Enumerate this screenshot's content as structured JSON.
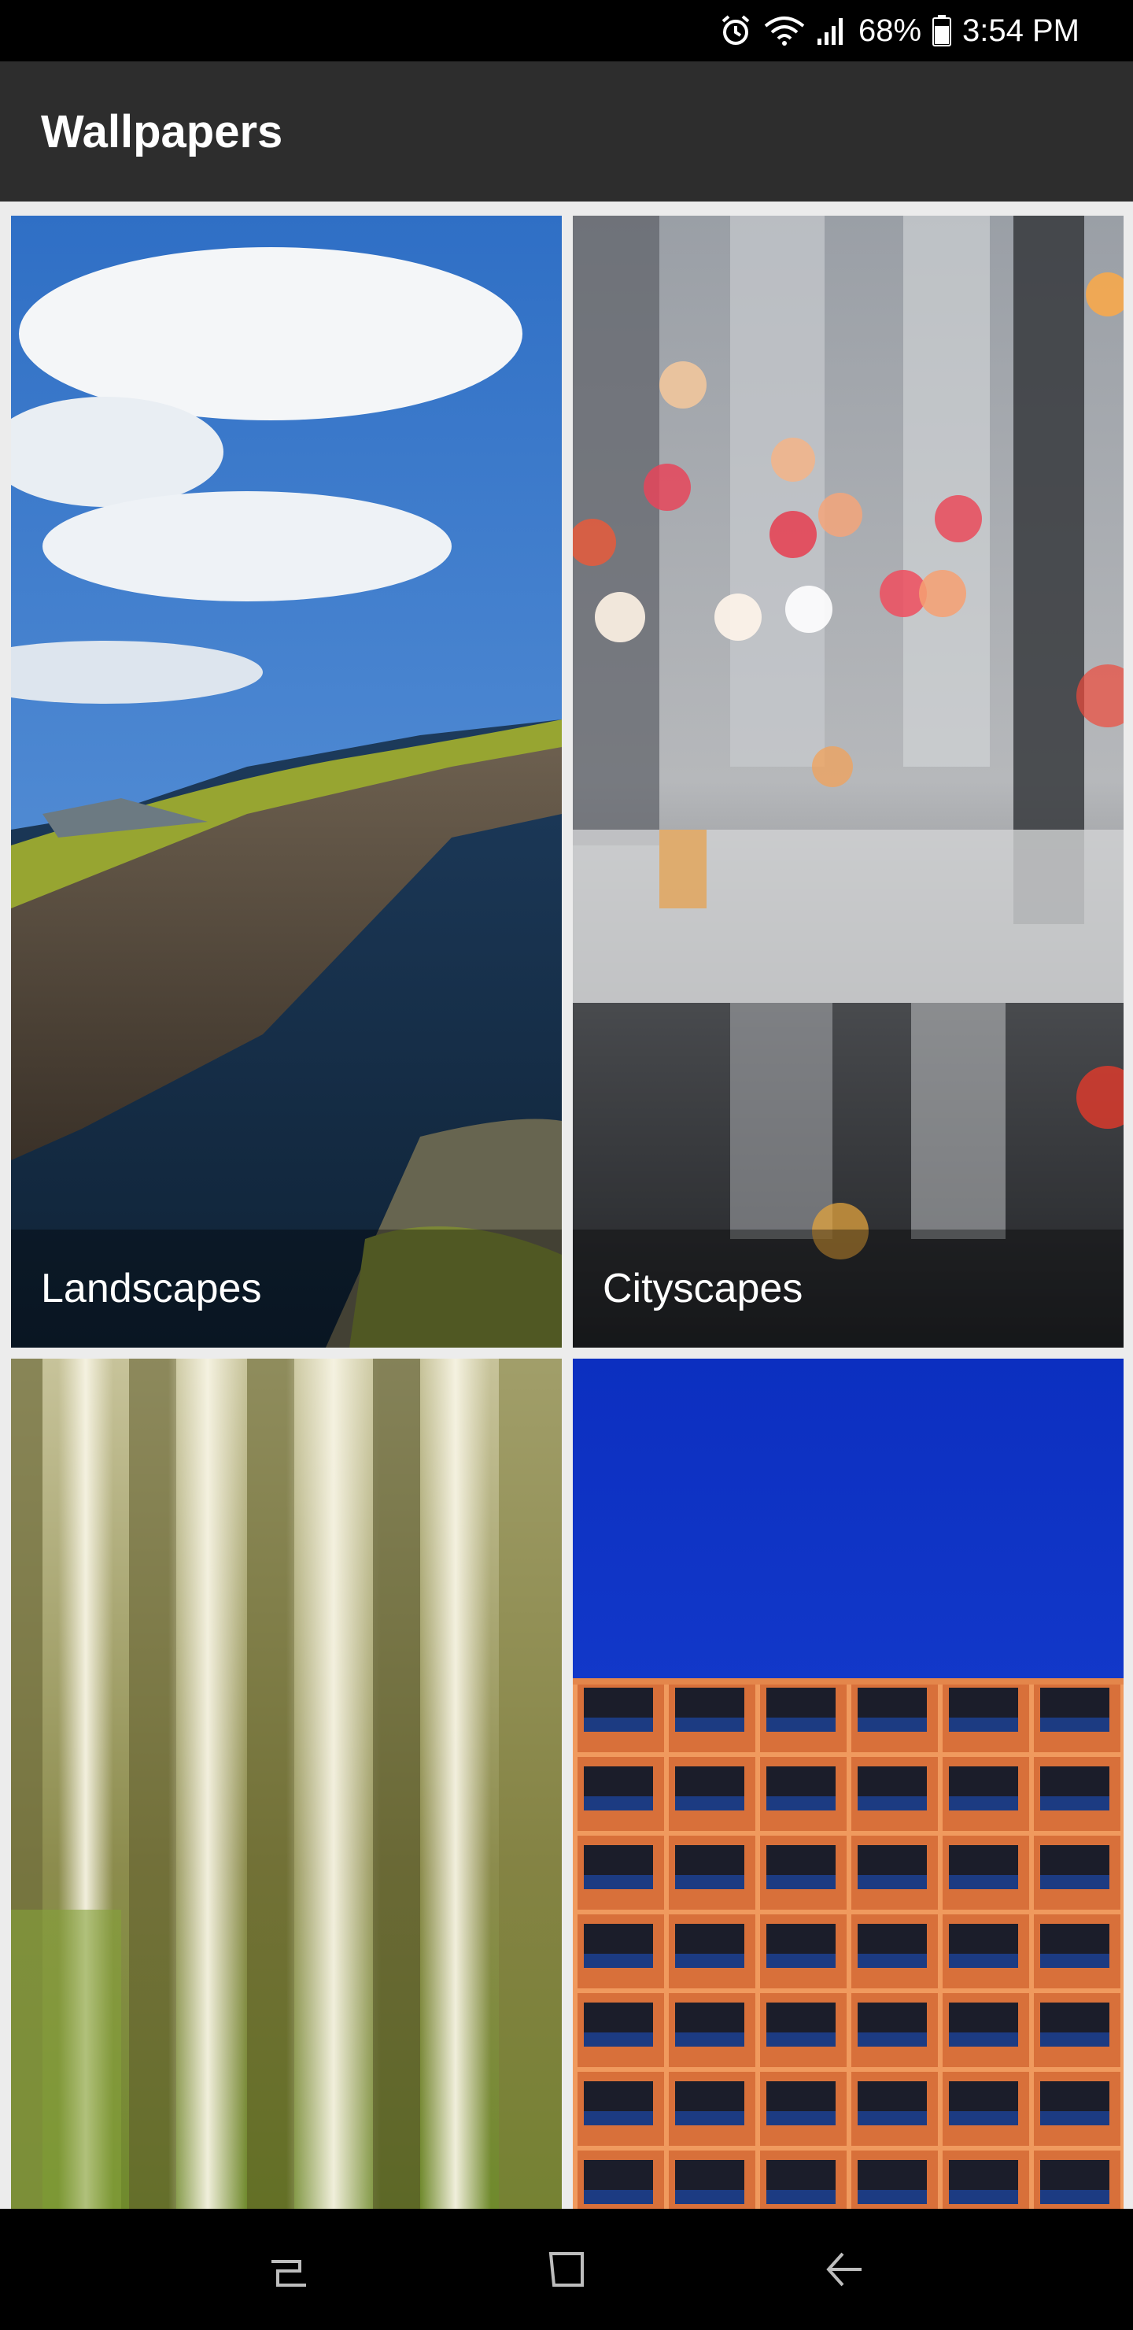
{
  "status_bar": {
    "battery_percent": "68%",
    "time": "3:54 PM",
    "icons": [
      "alarm-icon",
      "wifi-icon",
      "signal-icon",
      "battery-icon"
    ]
  },
  "app_bar": {
    "title": "Wallpapers"
  },
  "categories": [
    {
      "label": "Landscapes",
      "image": "sea-cliff-landscape"
    },
    {
      "label": "Cityscapes",
      "image": "rainy-city-bokeh"
    },
    {
      "label": "",
      "image": "blurred-birch-forest"
    },
    {
      "label": "",
      "image": "orange-building-facade"
    }
  ],
  "nav_bar": {
    "buttons": [
      "recents-icon",
      "home-icon",
      "back-icon"
    ]
  }
}
